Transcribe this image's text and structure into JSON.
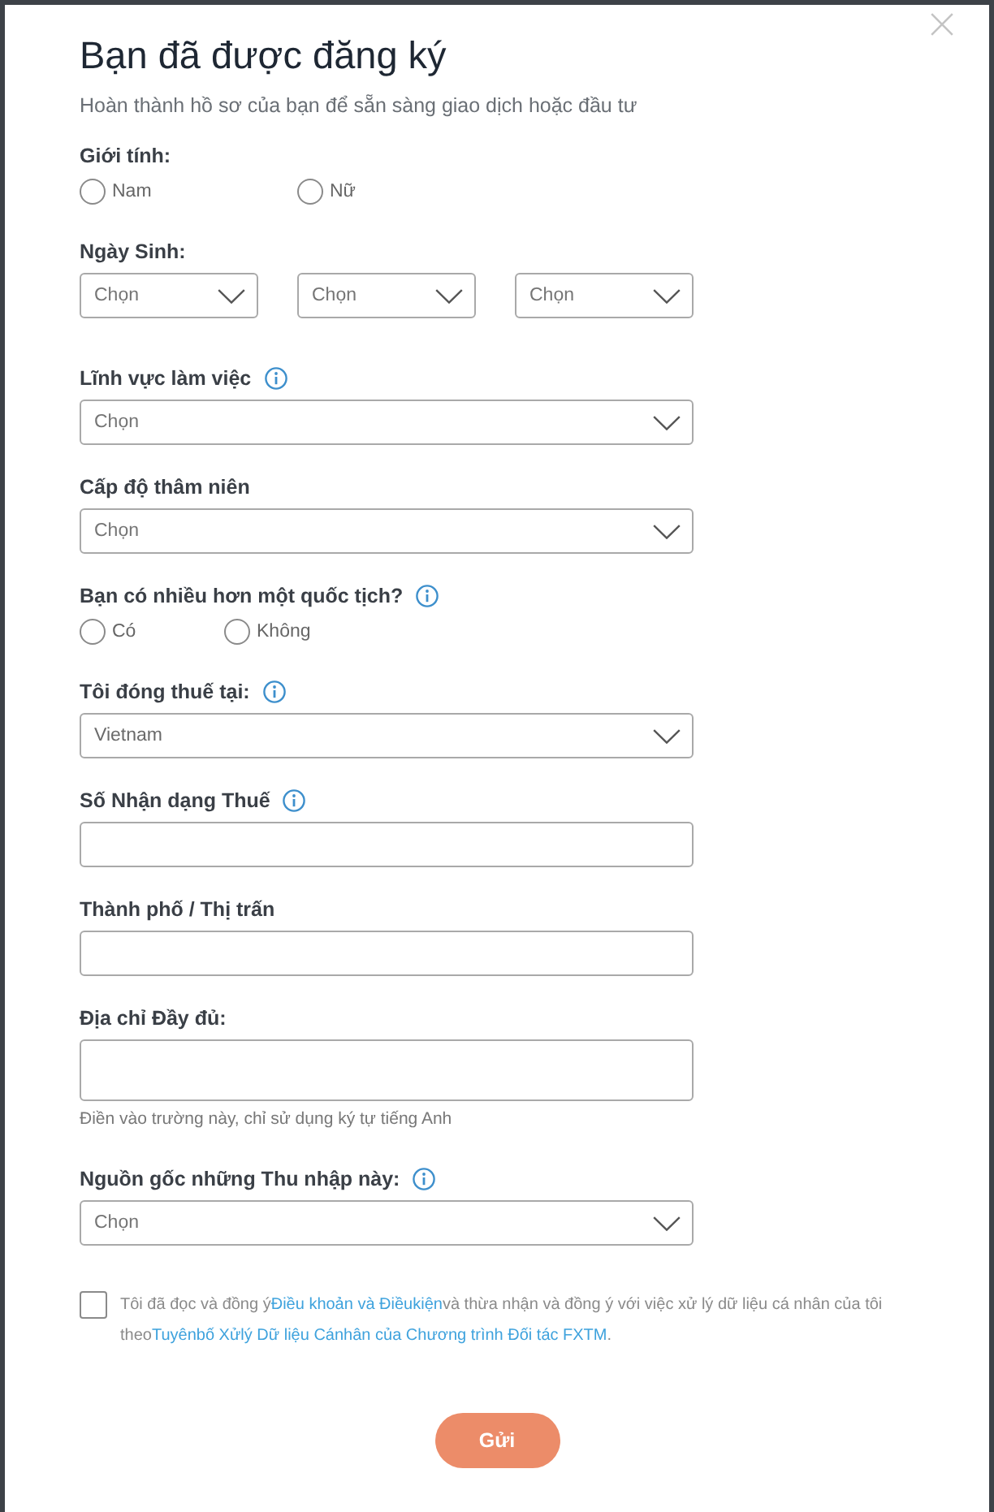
{
  "dialog": {
    "title": "Bạn đã được đăng ký",
    "subtitle": "Hoàn thành hồ sơ của bạn để sẵn sàng giao dịch hoặc đầu tư"
  },
  "fields": [
    {
      "kind": "radio",
      "label": "Giới tính:",
      "info": false,
      "options": [
        {
          "label": "Nam",
          "selected": false
        },
        {
          "label": "Nữ",
          "selected": false
        }
      ]
    },
    {
      "kind": "date",
      "label": "Ngày Sinh:",
      "info": false,
      "selects": [
        {
          "placeholder": "Chọn"
        },
        {
          "placeholder": "Chọn"
        },
        {
          "placeholder": "Chọn"
        }
      ]
    },
    {
      "kind": "select",
      "label": "Lĩnh vực làm việc",
      "info": true,
      "placeholder": "Chọn"
    },
    {
      "kind": "select",
      "label": "Cấp độ thâm niên",
      "info": false,
      "placeholder": "Chọn"
    },
    {
      "kind": "radio",
      "label": "Bạn có nhiều hơn một quốc tịch?",
      "info": true,
      "options": [
        {
          "label": "Có",
          "selected": false
        },
        {
          "label": "Không",
          "selected": false
        }
      ]
    },
    {
      "kind": "select",
      "label": "Tôi đóng thuế tại:",
      "info": true,
      "value": "Vietnam"
    },
    {
      "kind": "input",
      "label": "Số Nhận dạng Thuế",
      "info": true
    },
    {
      "kind": "input",
      "label": "Thành phố / Thị trấn",
      "info": false
    },
    {
      "kind": "textarea",
      "label": "Địa chỉ Đầy đủ:",
      "info": false,
      "hint": "Điền vào trường này, chỉ sử dụng ký tự tiếng Anh"
    },
    {
      "kind": "select",
      "label": "Nguồn gốc những Thu nhập này:",
      "info": true,
      "placeholder": "Chọn"
    }
  ],
  "consent": {
    "checked": false,
    "parts": [
      {
        "kind": "text",
        "text": "Tôi đã đọc và đồng ý"
      },
      {
        "kind": "link",
        "text": "Điều khoản và Điềukiện"
      },
      {
        "kind": "text",
        "text": "và thừa nhận và đồng ý với việc xử lý dữ liệu cá nhân của tôi theo"
      },
      {
        "kind": "link",
        "text": "Tuyênbố Xửlý Dữ liệu Cánhân của Chương trình Đối tác FXTM"
      },
      {
        "kind": "text",
        "text": "."
      }
    ]
  },
  "submit": {
    "label": "Gửi",
    "disabled": true
  }
}
